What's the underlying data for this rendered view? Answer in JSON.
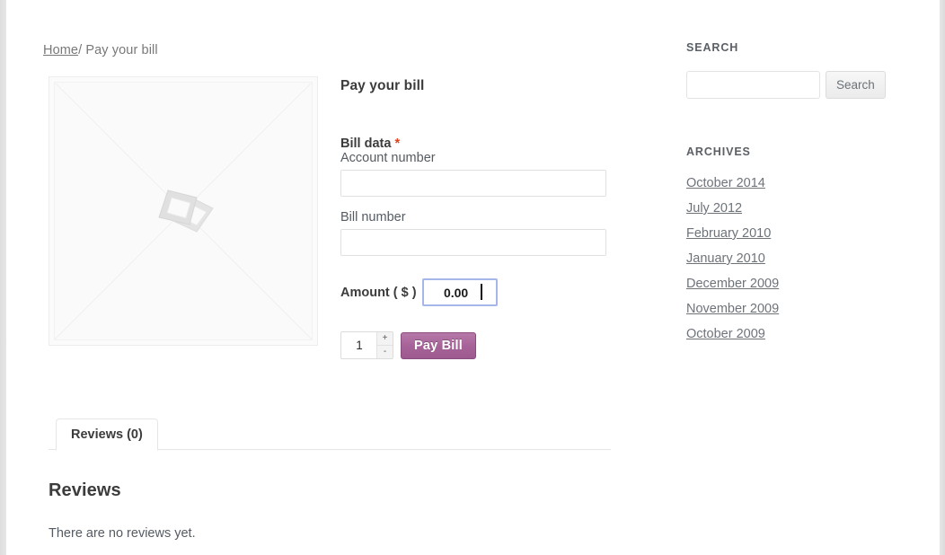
{
  "breadcrumb": {
    "home_label": "Home",
    "separator": "/",
    "current_label": "Pay your bill"
  },
  "product": {
    "image_placeholder_name": "placeholder-image",
    "title": "Pay your bill",
    "bill_data_label": "Bill data",
    "required_marker": "*",
    "fields": [
      {
        "label": "Account number",
        "value": "",
        "placeholder": ""
      },
      {
        "label": "Bill number",
        "value": "",
        "placeholder": ""
      }
    ],
    "amount_label": "Amount ( $ )",
    "amount_value": "0.00",
    "quantity_value": "1",
    "qty_increase_label": "+",
    "qty_decrease_label": "-",
    "pay_button_label": "Pay Bill",
    "accent_color": "#a46497",
    "focus_border_color": "#a5b6e8",
    "required_color": "#e2401c"
  },
  "tabs": {
    "items": [
      {
        "label": "Reviews (0)",
        "active": true
      }
    ],
    "panel": {
      "heading": "Reviews",
      "empty_message": "There are no reviews yet."
    }
  },
  "sidebar": {
    "search_widget": {
      "title": "SEARCH",
      "input_value": "",
      "input_placeholder": "",
      "button_label": "Search"
    },
    "archives_widget": {
      "title": "ARCHIVES",
      "items": [
        {
          "label": "October 2014"
        },
        {
          "label": "July 2012"
        },
        {
          "label": "February 2010"
        },
        {
          "label": "January 2010"
        },
        {
          "label": "December 2009"
        },
        {
          "label": "November 2009"
        },
        {
          "label": "October 2009"
        }
      ]
    }
  }
}
